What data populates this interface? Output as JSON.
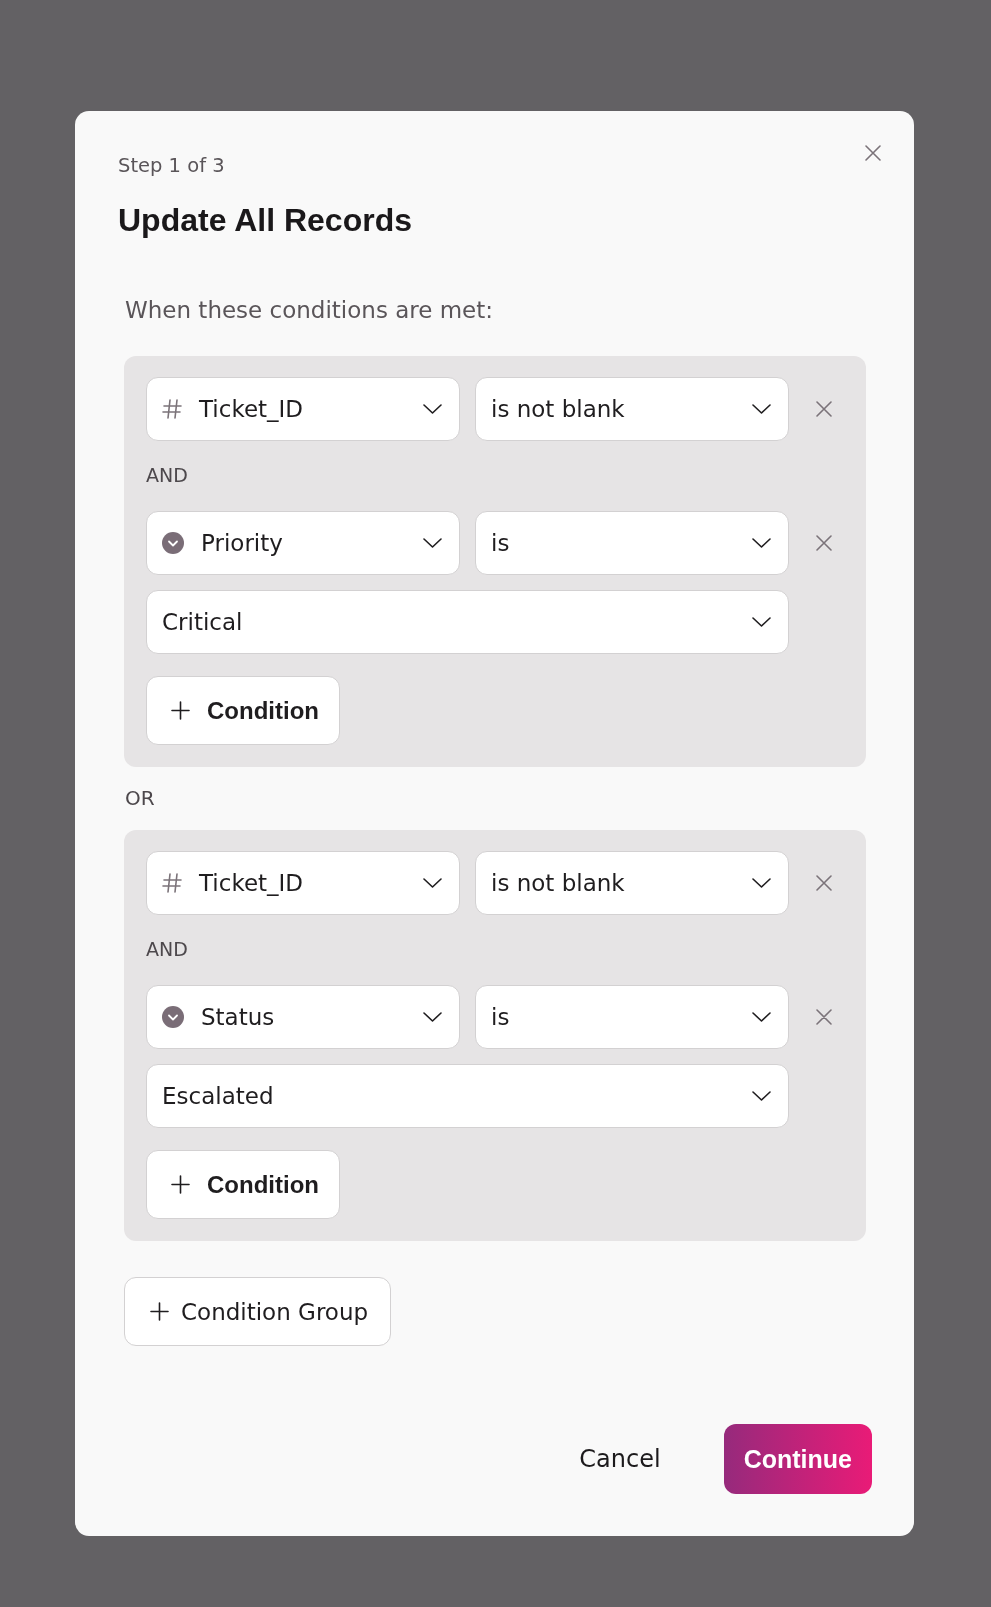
{
  "dialog": {
    "step": "Step 1 of 3",
    "title": "Update All Records",
    "intro": "When these conditions are met:"
  },
  "groups": [
    {
      "conditions": [
        {
          "field": {
            "kind": "number",
            "label": "Ticket_ID"
          },
          "operator": "is not blank"
        },
        {
          "connector": "AND",
          "field": {
            "kind": "select",
            "label": "Priority"
          },
          "operator": "is",
          "value": "Critical"
        }
      ],
      "add_button": "Condition"
    },
    {
      "separator": "OR",
      "conditions": [
        {
          "field": {
            "kind": "number",
            "label": "Ticket_ID"
          },
          "operator": "is not blank"
        },
        {
          "connector": "AND",
          "field": {
            "kind": "select",
            "label": "Status"
          },
          "operator": "is",
          "value": "Escalated"
        }
      ],
      "add_button": "Condition"
    }
  ],
  "add_group_button": "Condition Group",
  "footer": {
    "cancel": "Cancel",
    "continue": "Continue"
  }
}
